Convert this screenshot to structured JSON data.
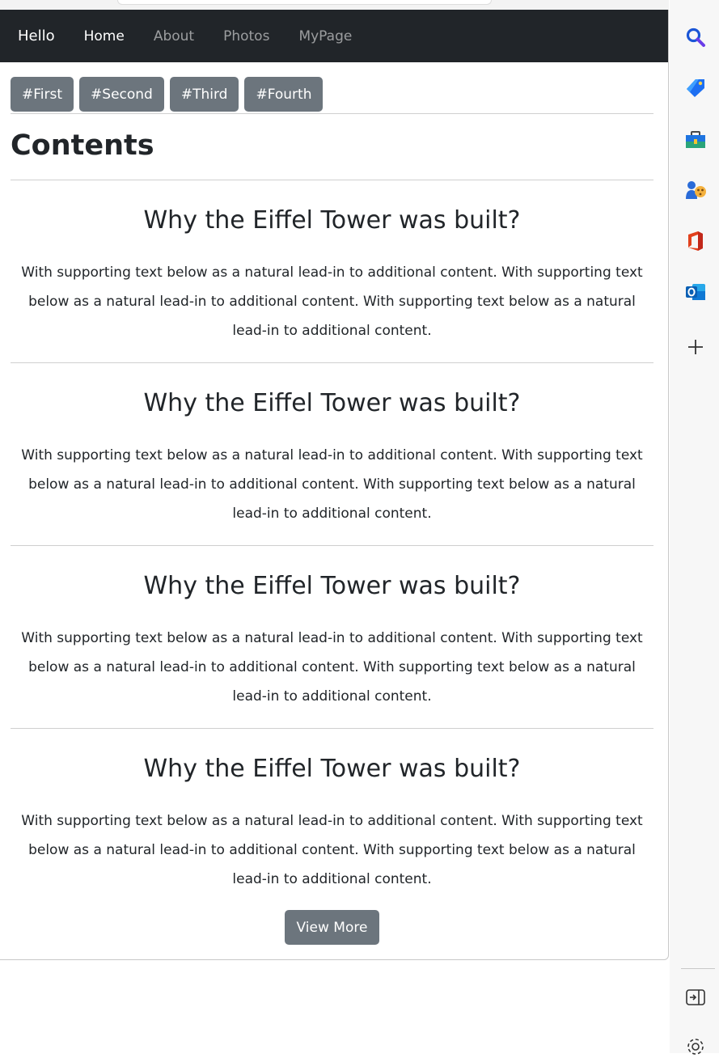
{
  "navbar": {
    "brand": "Hello",
    "links": [
      {
        "label": "Home",
        "active": true
      },
      {
        "label": "About",
        "active": false
      },
      {
        "label": "Photos",
        "active": false
      },
      {
        "label": "MyPage",
        "active": false
      }
    ]
  },
  "tags": [
    "#First",
    "#Second",
    "#Third",
    "#Fourth"
  ],
  "contents_title": "Contents",
  "articles": [
    {
      "title": "Why the Eiffel Tower was built?",
      "text": "With supporting text below as a natural lead-in to additional content. With supporting text below as a natural lead-in to additional content. With supporting text below as a natural lead-in to additional content."
    },
    {
      "title": "Why the Eiffel Tower was built?",
      "text": "With supporting text below as a natural lead-in to additional content. With supporting text below as a natural lead-in to additional content. With supporting text below as a natural lead-in to additional content."
    },
    {
      "title": "Why the Eiffel Tower was built?",
      "text": "With supporting text below as a natural lead-in to additional content. With supporting text below as a natural lead-in to additional content. With supporting text below as a natural lead-in to additional content."
    },
    {
      "title": "Why the Eiffel Tower was built?",
      "text": "With supporting text below as a natural lead-in to additional content. With supporting text below as a natural lead-in to additional content. With supporting text below as a natural lead-in to additional content."
    }
  ],
  "view_more_label": "View More",
  "colors": {
    "navbar_bg": "#212529",
    "button_bg": "#6c757d",
    "text": "#212529"
  },
  "browser_sidebar": {
    "icons": [
      "search-icon",
      "shopping-tag-icon",
      "toolbox-icon",
      "games-icon",
      "office-icon",
      "outlook-icon",
      "add-icon",
      "sidebar-toggle-icon",
      "settings-icon"
    ]
  }
}
